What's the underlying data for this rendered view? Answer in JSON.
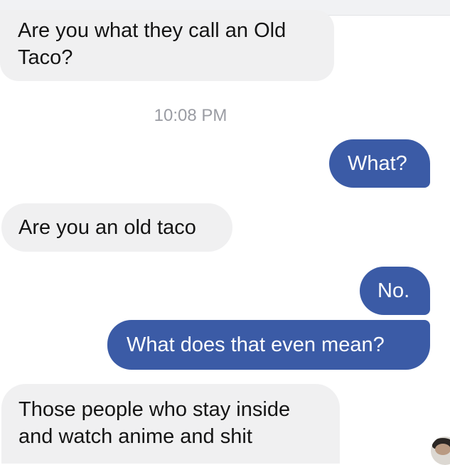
{
  "conversation": {
    "timestamp": "10:08 PM",
    "messages": [
      {
        "sender": "other",
        "text": "Are you what they call an Old\nTaco?"
      },
      {
        "sender": "me",
        "text": "What?"
      },
      {
        "sender": "other",
        "text": "Are you an old taco"
      },
      {
        "sender": "me",
        "text": "No."
      },
      {
        "sender": "me",
        "text": "What does that even mean?"
      },
      {
        "sender": "other",
        "text": "Those people who stay inside\nand watch anime and shit"
      }
    ]
  },
  "colors": {
    "incoming_bubble": "#f0f0f1",
    "outgoing_bubble": "#3b5ba6",
    "timestamp_text": "#9a9ca3"
  },
  "icons": {
    "avatar": "user-avatar-photo"
  }
}
